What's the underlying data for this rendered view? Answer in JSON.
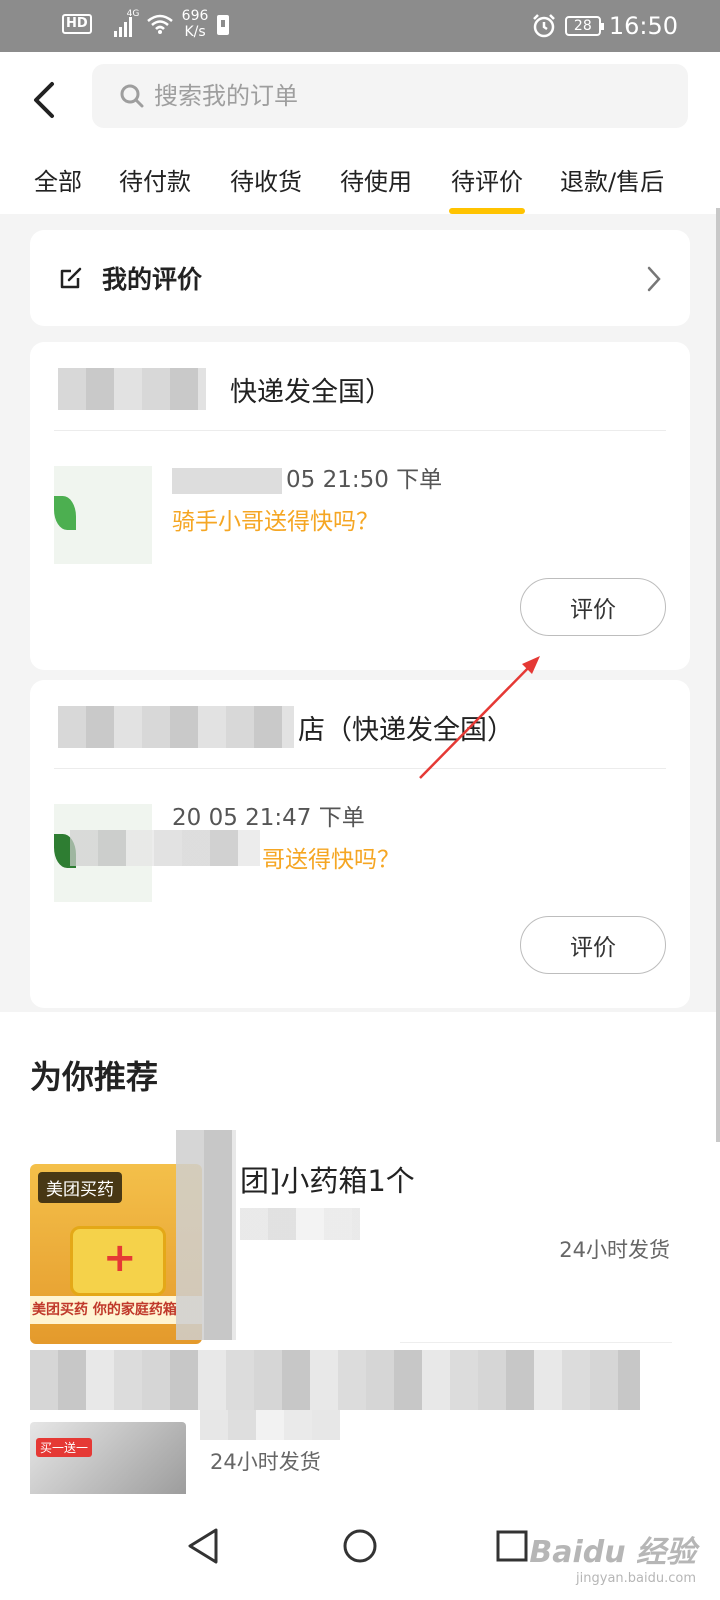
{
  "status_bar": {
    "hd": "HD",
    "network": "4G",
    "speed": "696\nK/s",
    "battery": "28",
    "time": "16:50"
  },
  "header": {
    "search_placeholder": "搜索我的订单",
    "tabs": [
      "全部",
      "待付款",
      "待收货",
      "待使用",
      "待评价",
      "退款/售后"
    ],
    "active_tab": "待评价"
  },
  "my_reviews": {
    "label": "我的评价"
  },
  "orders": [
    {
      "shop_suffix": "快递发全国）",
      "time": "05 21:50 下单",
      "question": "骑手小哥送得快吗？",
      "button": "评价"
    },
    {
      "shop_suffix": "店（快递发全国）",
      "time": "20     05 21:47 下单",
      "question": "哥送得快吗？",
      "button": "评价"
    }
  ],
  "recommend": {
    "title": "为你推荐",
    "items": [
      {
        "tag": "美团买药",
        "banner": "美团买药 你的家庭药箱",
        "name": "团]小药箱1个",
        "shipping": "24小时发货"
      },
      {
        "tag": "买一送一",
        "shipping": "24小时发货"
      }
    ]
  },
  "watermark": {
    "logo": "Baidu 经验",
    "url": "jingyan.baidu.com"
  },
  "colors": {
    "accent": "#ffc300",
    "question": "#f5a623",
    "status_bar": "#8c8c8c",
    "annotation_arrow": "#e53935"
  }
}
